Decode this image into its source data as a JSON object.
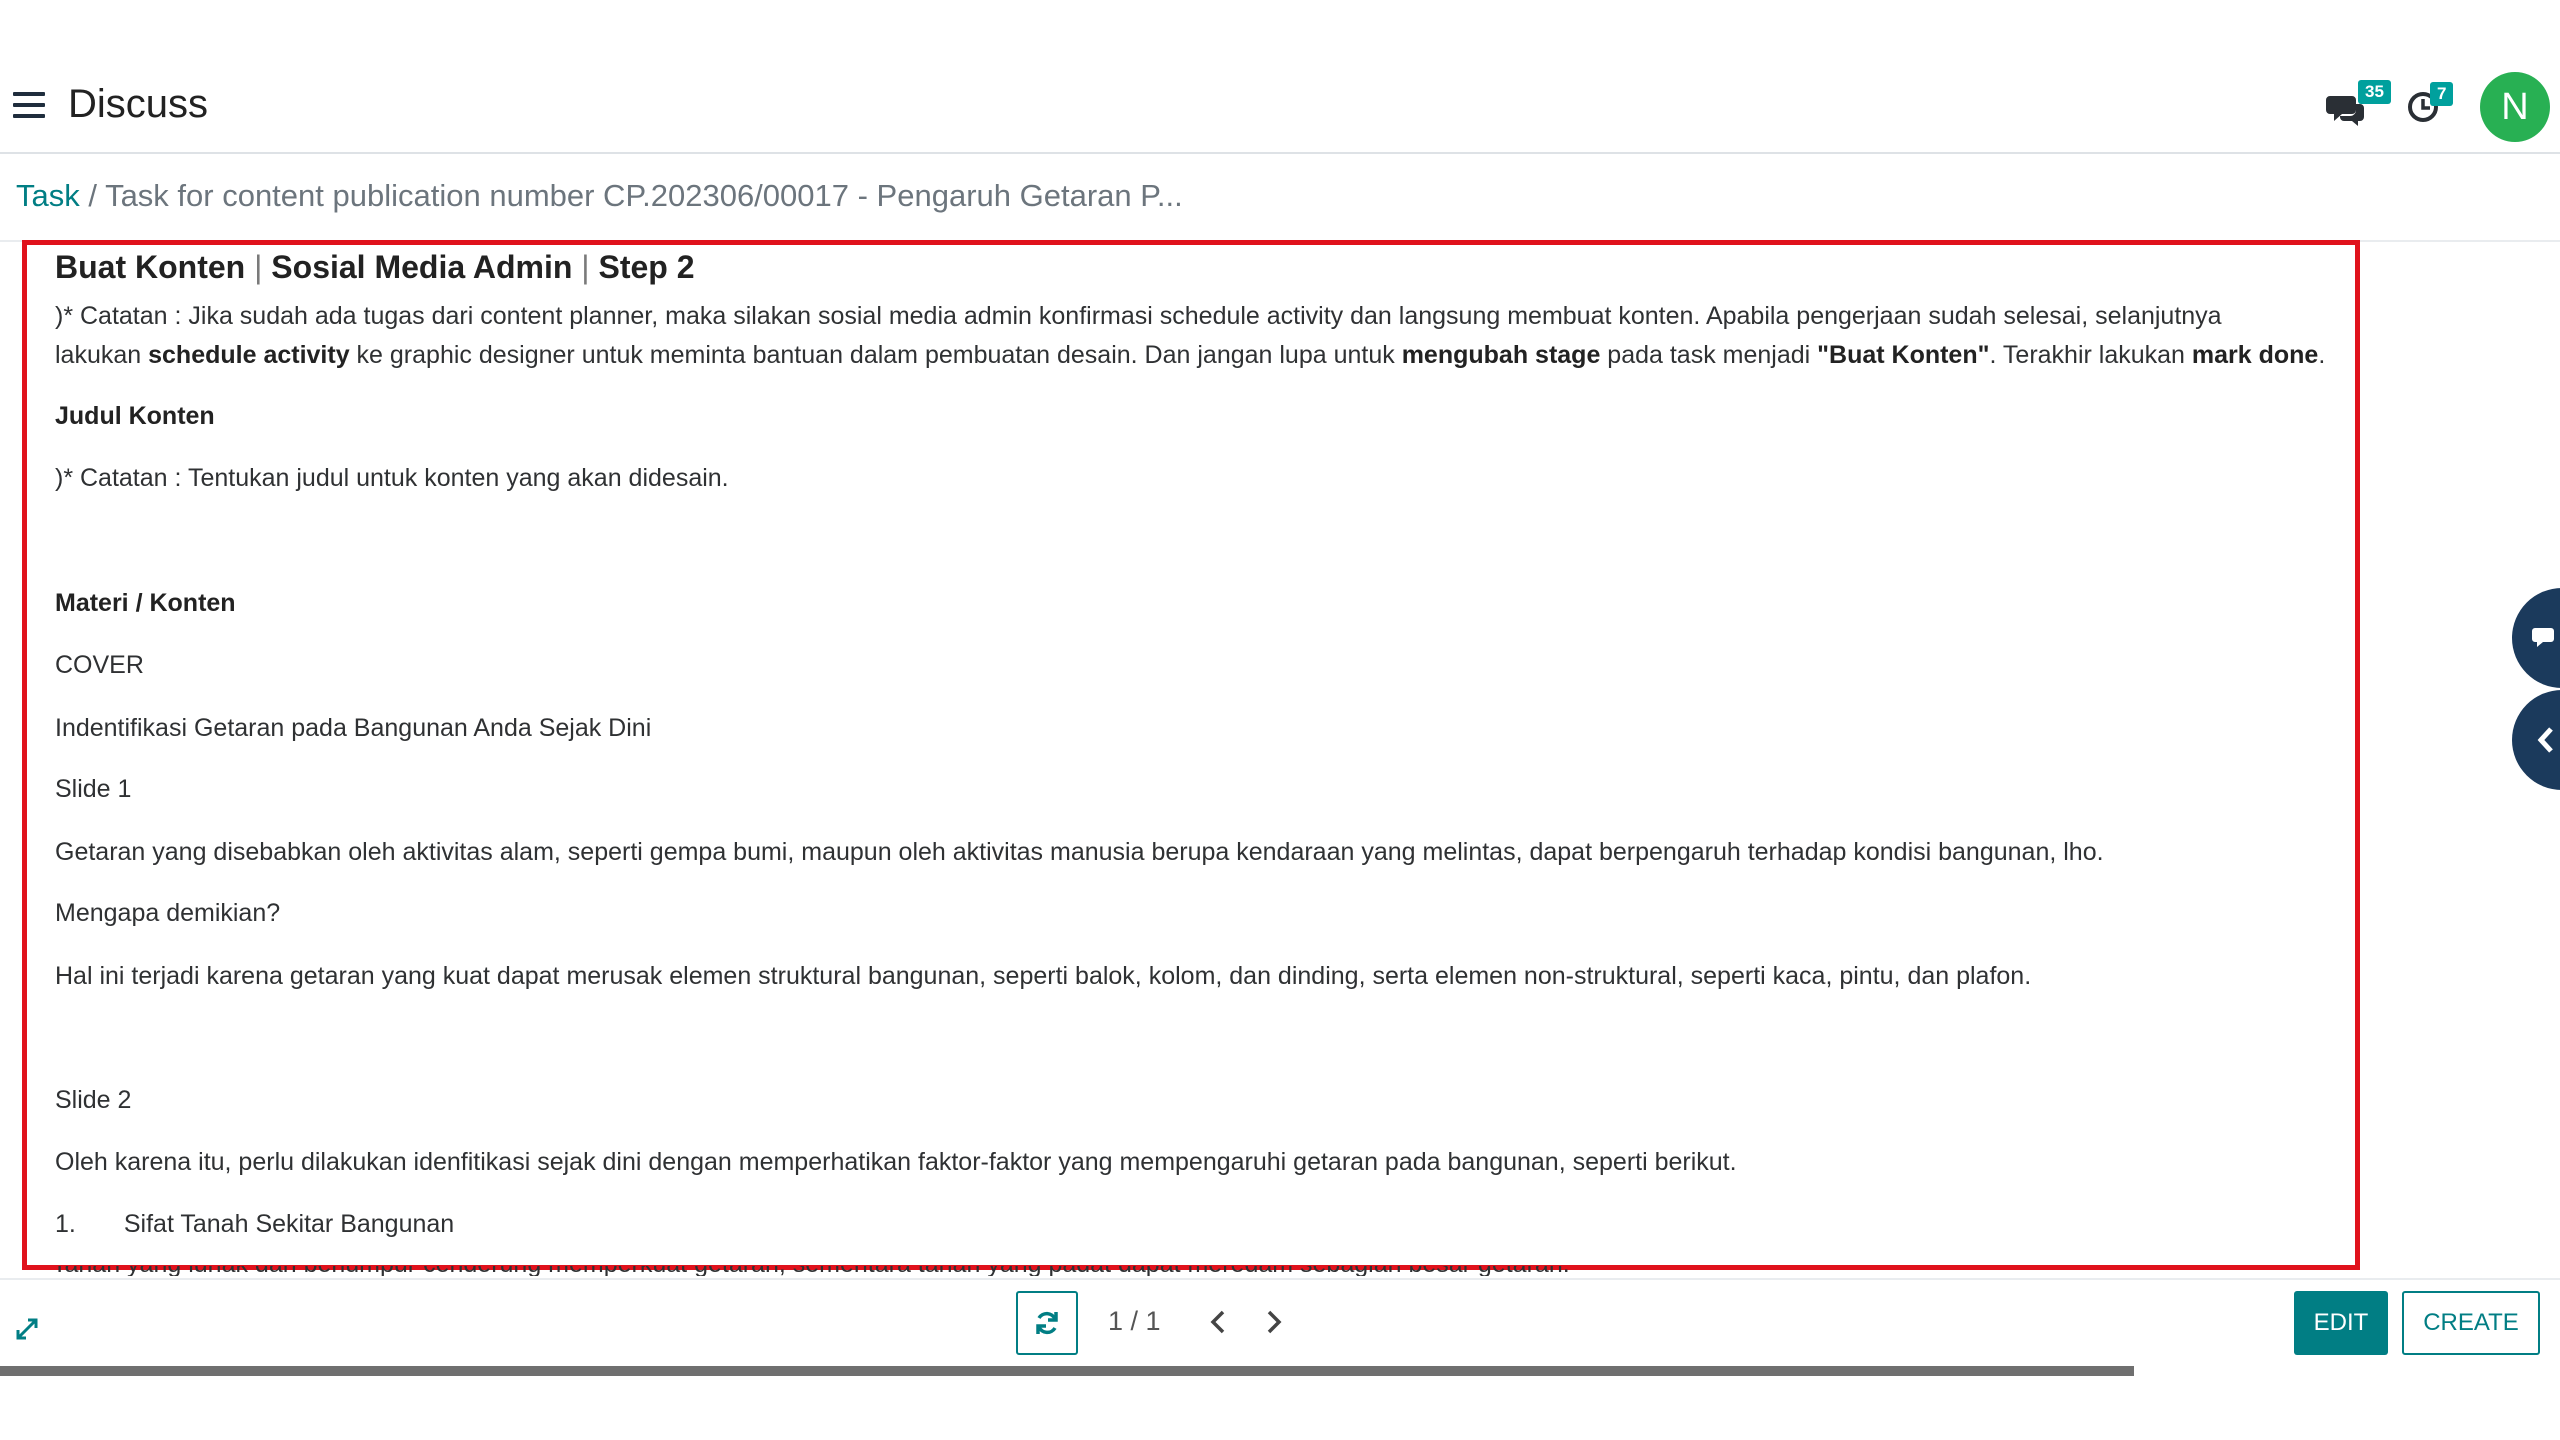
{
  "app": {
    "title": "Discuss"
  },
  "header": {
    "messages_badge": "35",
    "activities_badge": "7",
    "avatar_initial": "N",
    "avatar_color": "#28b053",
    "icons": [
      "menu-icon",
      "chat-icon",
      "clock-icon"
    ]
  },
  "breadcrumb": {
    "parent": "Task",
    "separator": "/",
    "current": "Task for content publication number CP.202306/00017 - Pengaruh Getaran P..."
  },
  "task": {
    "title": {
      "part1": "Buat Konten",
      "sep": "|",
      "part2": "Sosial Media Admin",
      "part3": "Step 2"
    },
    "note1": {
      "l1": ")* Catatan : Jika sudah ada tugas dari content planner, maka silakan sosial media admin konfirmasi schedule activity dan langsung membuat konten. Apabila pengerjaan sudah selesai, selanjutnya",
      "l2_a": "lakukan ",
      "l2_b": "schedule activity",
      "l2_c": " ke graphic designer untuk meminta bantuan dalam pembuatan desain. Dan jangan lupa untuk ",
      "l2_d": "mengubah stage",
      "l2_e": " pada task menjadi ",
      "l2_f": "\"Buat Konten\"",
      "l2_g": ". Terakhir lakukan ",
      "l2_h": "mark done",
      "l2_i": "."
    },
    "judul_heading": "Judul Konten",
    "note2": ")* Catatan : Tentukan judul untuk konten yang akan didesain.",
    "materi_heading": "Materi / Konten",
    "cover": "COVER",
    "cover_text": "Indentifikasi Getaran pada Bangunan Anda Sejak Dini",
    "slide1": "Slide 1",
    "slide1_p1": "Getaran yang disebabkan oleh aktivitas alam, seperti gempa bumi, maupun oleh aktivitas manusia berupa kendaraan yang melintas, dapat berpengaruh terhadap kondisi bangunan, lho.",
    "slide1_q": "Mengapa demikian?",
    "slide1_p2": "Hal ini terjadi karena getaran yang kuat dapat merusak elemen struktural bangunan, seperti balok, kolom, dan dinding, serta elemen non-struktural, seperti kaca, pintu, dan plafon.",
    "slide2": "Slide 2",
    "slide2_p1": "Oleh karena itu, perlu dilakukan idenfitikasi sejak dini dengan memperhatikan faktor-faktor yang mempengaruhi getaran pada bangunan, seperti berikut.",
    "list_num": "1.",
    "list_item": "Sifat Tanah Sekitar Bangunan",
    "cut_text": "Tanah yang lunak dan berlumpur cenderung memperkuat getaran, sementara tanah yang padat dapat meredam sebagian besar getaran."
  },
  "pager": {
    "text": "1 / 1"
  },
  "buttons": {
    "edit": "EDIT",
    "create": "CREATE"
  },
  "colors": {
    "accent": "#017e84",
    "highlight_border": "#e0121c",
    "badge": "#00a09d",
    "float": "#1b3a5c"
  }
}
